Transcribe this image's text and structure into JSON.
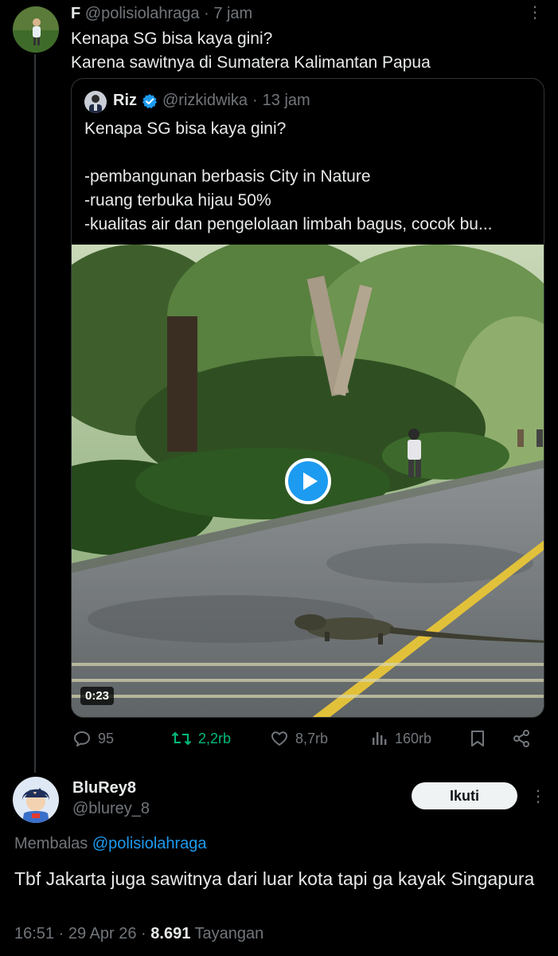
{
  "parent_tweet": {
    "display_name": "F",
    "handle": "@polisiolahraga",
    "separator": "·",
    "time": "7 jam",
    "text_line1": "Kenapa SG bisa kaya gini?",
    "text_line2": "Karena sawitnya di Sumatera Kalimantan Papua",
    "more_icon": "more-vertical-icon"
  },
  "quoted_tweet": {
    "display_name": "Riz",
    "verified_icon": "verified-badge-icon",
    "handle": "@rizkidwika",
    "separator": "·",
    "time": "13 jam",
    "text": "Kenapa SG bisa kaya gini?\n\n-pembangunan berbasis City in Nature\n-ruang terbuka hijau 50%\n-kualitas air dan pengelolaan limbah bagus, cocok bu...",
    "video": {
      "duration": "0:23",
      "play_icon": "play-icon"
    }
  },
  "actions": {
    "replies": "95",
    "retweets": "2,2rb",
    "likes": "8,7rb",
    "views": "160rb",
    "reply_icon": "reply-icon",
    "retweet_icon": "retweet-icon",
    "like_icon": "heart-icon",
    "views_icon": "views-chart-icon",
    "bookmark_icon": "bookmark-icon",
    "share_icon": "share-icon"
  },
  "reply_tweet": {
    "display_name": "BluRey8",
    "handle": "@blurey_8",
    "follow_label": "Ikuti",
    "replying_prefix": "Membalas",
    "replying_to": "@polisiolahraga",
    "text": "Tbf Jakarta juga sawitnya dari luar kota tapi ga kayak Singapura",
    "time": "16:51",
    "separator1": "·",
    "date": "29 Apr 26",
    "separator2": "·",
    "views_count": "8.691",
    "views_label": "Tayangan"
  },
  "colors": {
    "background": "#000000",
    "text_primary": "#e7e9ea",
    "text_muted": "#71767b",
    "accent_blue": "#1d9bf0",
    "retweet_green": "#00ba7c",
    "follow_button_bg": "#eff3f4"
  }
}
